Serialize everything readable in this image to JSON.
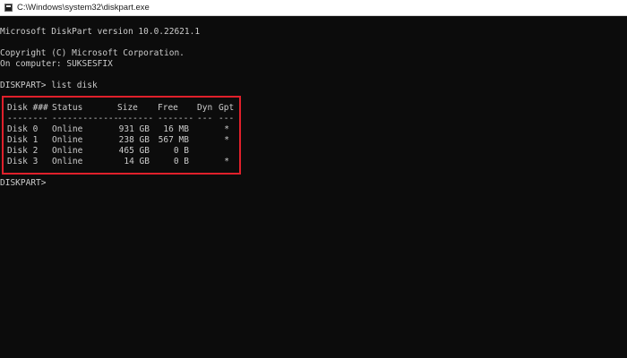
{
  "window": {
    "title": "C:\\Windows\\system32\\diskpart.exe"
  },
  "console": {
    "version_line": "Microsoft DiskPart version 10.0.22621.1",
    "copyright_line": "Copyright (C) Microsoft Corporation.",
    "computer_line": "On computer: SUKSESFIX",
    "command_prompt": "DISKPART> list disk",
    "final_prompt": "DISKPART>"
  },
  "disk_table": {
    "headers": [
      "Disk ###",
      "Status",
      "Size",
      "Free",
      "Dyn",
      "Gpt"
    ],
    "separators": [
      "--------",
      "-------------",
      "-------",
      "-------",
      "---",
      "---"
    ],
    "rows": [
      {
        "disk": "Disk 0",
        "status": "Online",
        "size": "931 GB",
        "free": "16 MB",
        "dyn": "",
        "gpt": "*"
      },
      {
        "disk": "Disk 1",
        "status": "Online",
        "size": "238 GB",
        "free": "567 MB",
        "dyn": "",
        "gpt": "*"
      },
      {
        "disk": "Disk 2",
        "status": "Online",
        "size": "465 GB",
        "free": "0 B",
        "dyn": "",
        "gpt": ""
      },
      {
        "disk": "Disk 3",
        "status": "Online",
        "size": "14 GB",
        "free": "0 B",
        "dyn": "",
        "gpt": "*"
      }
    ]
  },
  "colors": {
    "background": "#0c0c0c",
    "text": "#cccccc",
    "highlight_border": "#e0202b",
    "titlebar": "#ffffff"
  }
}
